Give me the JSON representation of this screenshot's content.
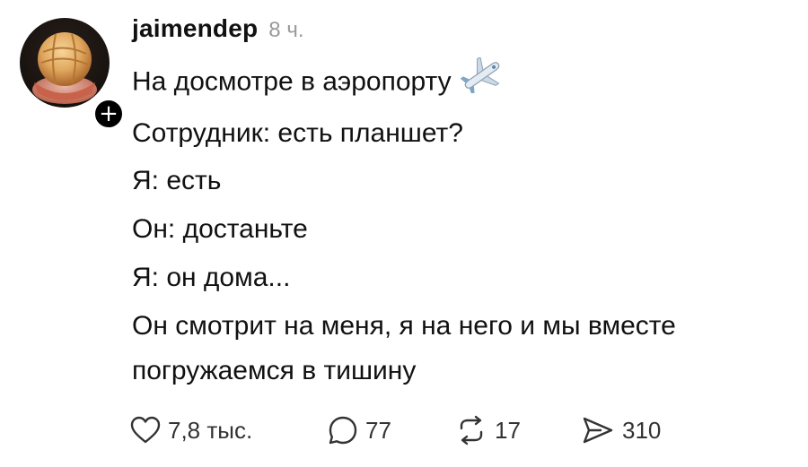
{
  "post": {
    "author": "jaimendep",
    "time": "8 ч.",
    "lines": [
      "На досмотре в аэропорту",
      "Сотрудник: есть планшет?",
      "Я: есть",
      "Он: достаньте",
      "Я: он дома...",
      "Он смотрит на меня, я на него и мы вместе",
      "погружаемся в тишину"
    ],
    "emoji": "airplane-icon",
    "follow_label": "+"
  },
  "actions": {
    "likes": "7,8 тыс.",
    "replies": "77",
    "reposts": "17",
    "shares": "310"
  },
  "icons": [
    "heart-icon",
    "comment-icon",
    "repost-icon",
    "share-icon",
    "airplane-icon"
  ]
}
